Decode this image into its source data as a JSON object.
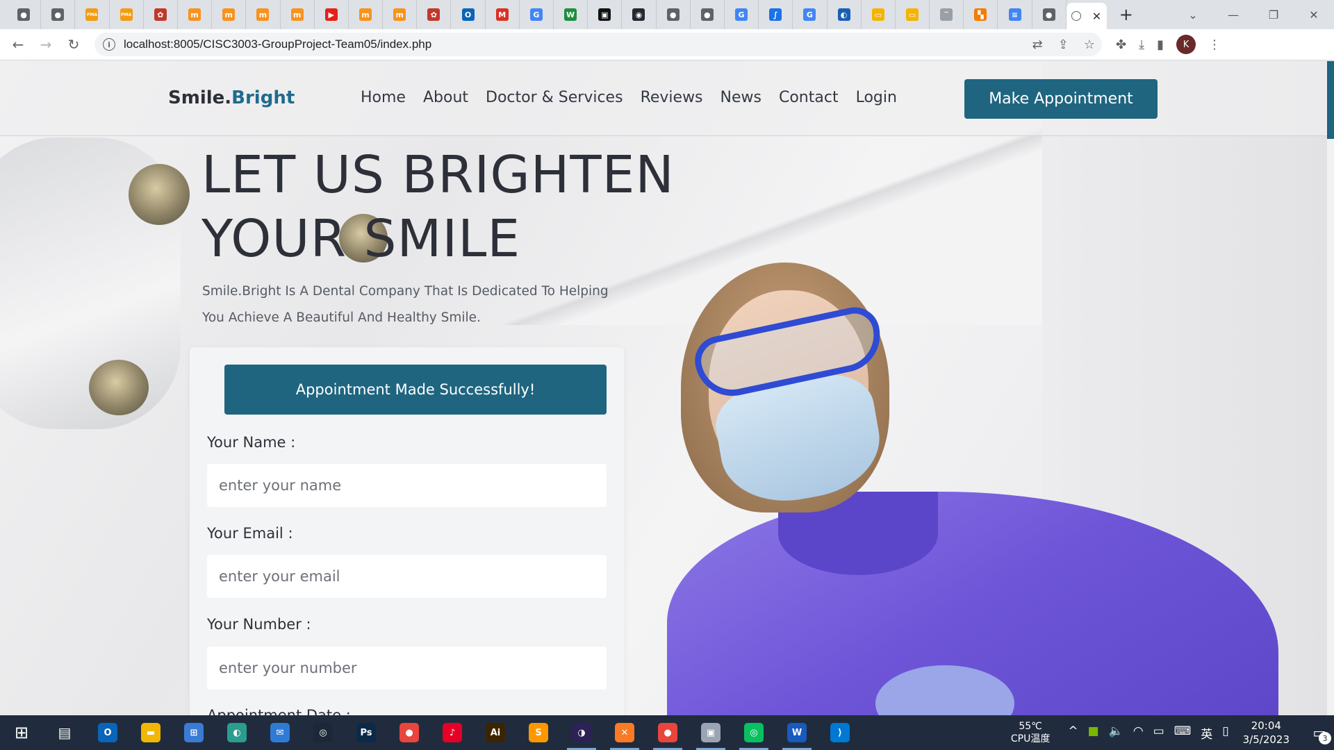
{
  "browser": {
    "url": "localhost:8005/CISC3003-GroupProject-Team05/index.php",
    "tabs": [
      {
        "icon": "chrome-icon",
        "glyph": "●",
        "color": "#5f6368"
      },
      {
        "icon": "chrome-icon",
        "glyph": "●",
        "color": "#5f6368"
      },
      {
        "icon": "pma-icon",
        "glyph": "PMA",
        "color": "#f39c12"
      },
      {
        "icon": "pma-icon",
        "glyph": "PMA",
        "color": "#f39c12"
      },
      {
        "icon": "tomcat-icon",
        "glyph": "✿",
        "color": "#c0392b"
      },
      {
        "icon": "moodle-icon",
        "glyph": "m",
        "color": "#f7931e"
      },
      {
        "icon": "moodle-icon",
        "glyph": "m",
        "color": "#f7931e"
      },
      {
        "icon": "moodle-icon",
        "glyph": "m",
        "color": "#f7931e"
      },
      {
        "icon": "moodle-icon",
        "glyph": "m",
        "color": "#f7931e"
      },
      {
        "icon": "youtube-icon",
        "glyph": "▶",
        "color": "#e62117"
      },
      {
        "icon": "moodle-icon",
        "glyph": "m",
        "color": "#f7931e"
      },
      {
        "icon": "moodle-icon",
        "glyph": "m",
        "color": "#f7931e"
      },
      {
        "icon": "tomcat-icon",
        "glyph": "✿",
        "color": "#c0392b"
      },
      {
        "icon": "outlook-icon",
        "glyph": "O",
        "color": "#0a64b7"
      },
      {
        "icon": "gmail-icon",
        "glyph": "M",
        "color": "#d93025"
      },
      {
        "icon": "google-icon",
        "glyph": "G",
        "color": "#4285f4"
      },
      {
        "icon": "w-icon",
        "glyph": "W",
        "color": "#1e8e3e"
      },
      {
        "icon": "notion-icon",
        "glyph": "▣",
        "color": "#111111"
      },
      {
        "icon": "github-icon",
        "glyph": "◉",
        "color": "#24292f"
      },
      {
        "icon": "chrome-icon",
        "glyph": "●",
        "color": "#5f6368"
      },
      {
        "icon": "chrome-icon",
        "glyph": "●",
        "color": "#5f6368"
      },
      {
        "icon": "google-icon",
        "glyph": "G",
        "color": "#4285f4"
      },
      {
        "icon": "script-icon",
        "glyph": "∫",
        "color": "#1a73e8"
      },
      {
        "icon": "google-icon",
        "glyph": "G",
        "color": "#4285f4"
      },
      {
        "icon": "edge-icon",
        "glyph": "◐",
        "color": "#1a5fb4"
      },
      {
        "icon": "slides-icon",
        "glyph": "▭",
        "color": "#f4b400"
      },
      {
        "icon": "slides-icon",
        "glyph": "▭",
        "color": "#f4b400"
      },
      {
        "icon": "blank-icon",
        "glyph": "‾",
        "color": "#9aa0a6"
      },
      {
        "icon": "sheets-icon",
        "glyph": "▚",
        "color": "#f57c00"
      },
      {
        "icon": "docs-icon",
        "glyph": "≡",
        "color": "#4285f4"
      },
      {
        "icon": "chrome-icon",
        "glyph": "●",
        "color": "#5f6368"
      }
    ]
  },
  "site": {
    "logo_main": "Smile.",
    "logo_accent": "Bright",
    "nav": [
      "Home",
      "About",
      "Doctor & Services",
      "Reviews",
      "News",
      "Contact",
      "Login"
    ],
    "cta_label": "Make Appointment",
    "hero_line1": "LET US BRIGHTEN",
    "hero_line2": "YOUR SMILE",
    "hero_desc": "Smile.Bright Is A Dental Company That Is Dedicated To Helping You Achieve A Beautiful And Healthy Smile.",
    "success_label": "Appointment Made Successfully!",
    "form": {
      "name_label": "Your Name :",
      "name_placeholder": "enter your name",
      "email_label": "Your Email :",
      "email_placeholder": "enter your email",
      "number_label": "Your Number :",
      "number_placeholder": "enter your number",
      "date_label": "Appointment Date :"
    },
    "colors": {
      "accent": "#1f6580",
      "logo_accent": "#1f6b8c"
    }
  },
  "taskbar": {
    "apps": [
      {
        "name": "outlook-app-icon",
        "glyph": "O",
        "color": "#0a64b7",
        "running": false
      },
      {
        "name": "file-explorer-icon",
        "glyph": "▬",
        "color": "#f2b705",
        "running": false
      },
      {
        "name": "ms-store-icon",
        "glyph": "⊞",
        "color": "#3a7bd5",
        "running": false
      },
      {
        "name": "edge-app-icon",
        "glyph": "◐",
        "color": "#2a9d8f",
        "running": false
      },
      {
        "name": "mail-icon",
        "glyph": "✉",
        "color": "#2e7bd6",
        "running": false
      },
      {
        "name": "steam-icon",
        "glyph": "◎",
        "color": "#1b2838",
        "running": false
      },
      {
        "name": "photoshop-icon",
        "glyph": "Ps",
        "color": "#0b2a4a",
        "running": false
      },
      {
        "name": "chrome-app-icon",
        "glyph": "●",
        "color": "#e8453c",
        "running": false
      },
      {
        "name": "netease-music-icon",
        "glyph": "♪",
        "color": "#e60026",
        "running": false
      },
      {
        "name": "illustrator-icon",
        "glyph": "Ai",
        "color": "#3d2400",
        "running": false
      },
      {
        "name": "sublime-icon",
        "glyph": "S",
        "color": "#ff9800",
        "running": false
      },
      {
        "name": "eclipse-icon",
        "glyph": "◑",
        "color": "#2c2255",
        "running": true
      },
      {
        "name": "xampp-icon",
        "glyph": "✕",
        "color": "#fb7a24",
        "running": true
      },
      {
        "name": "chrome-profile-icon",
        "glyph": "●",
        "color": "#e8453c",
        "running": true
      },
      {
        "name": "photos-icon",
        "glyph": "▣",
        "color": "#9aa4b2",
        "running": true
      },
      {
        "name": "wechat-icon",
        "glyph": "◎",
        "color": "#07c160",
        "running": true
      },
      {
        "name": "word-icon",
        "glyph": "W",
        "color": "#185abd",
        "running": true
      },
      {
        "name": "vscode-icon",
        "glyph": "⟩",
        "color": "#0078d4",
        "running": false
      }
    ],
    "temp_line1": "55℃",
    "temp_line2": "CPU温度",
    "ime": "英",
    "time": "20:04",
    "date": "3/5/2023",
    "notifications": "3"
  }
}
